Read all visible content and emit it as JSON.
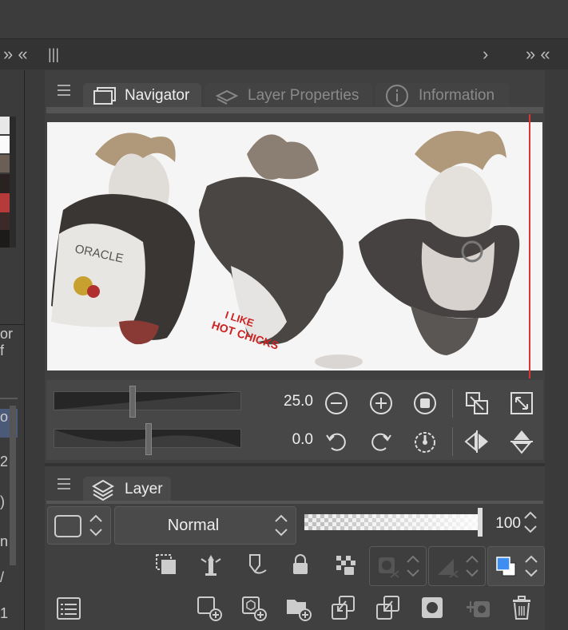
{
  "dock": {
    "left_glyph": "» «",
    "grip_glyph": "|||",
    "right_glyph": "›",
    "right2_glyph": "» «"
  },
  "left_panel": {
    "text_row1": "or f",
    "text_rows": [
      "o",
      "2",
      ")",
      "n",
      "/",
      "1"
    ]
  },
  "tabs": {
    "navigator": "Navigator",
    "layer_properties": "Layer Properties",
    "information": "Information"
  },
  "navigator": {
    "zoom_value": "25.0",
    "rotation_value": "0.0",
    "canvas_texts": {
      "oracle": "ORACLE",
      "hot1": "I LIKE",
      "hot2": "HOT CHICKS"
    }
  },
  "layer_panel": {
    "tab_label": "Layer",
    "blend_mode": "Normal",
    "opacity_value": "100",
    "opacity_fraction": 1.0
  },
  "colors": {
    "accent_blue": "#3d8ef0",
    "guide_red": "#d33333",
    "panel_bg": "#404040"
  }
}
